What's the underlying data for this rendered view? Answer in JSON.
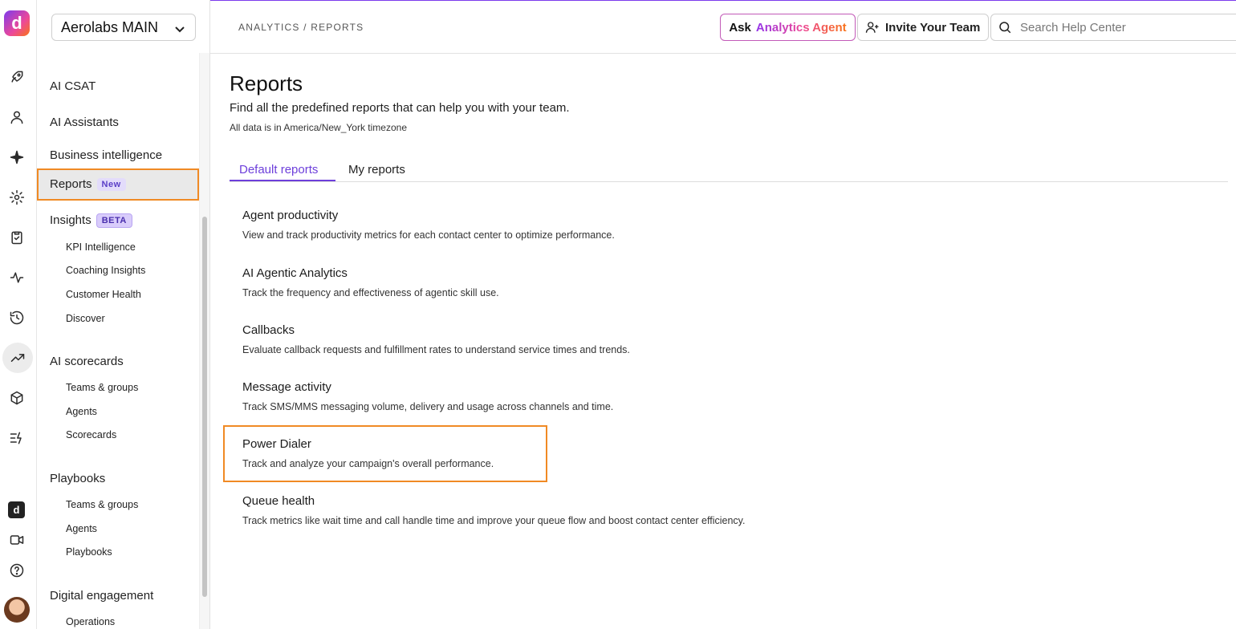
{
  "workspace": {
    "name": "Aerolabs MAIN"
  },
  "breadcrumb": "ANALYTICS / REPORTS",
  "header": {
    "ask_prefix": "Ask",
    "ask_agent": "Analytics Agent",
    "invite": "Invite Your Team",
    "search_placeholder": "Search Help Center"
  },
  "sidebar": {
    "items": [
      {
        "label": "AI CSAT"
      },
      {
        "label": "AI Assistants"
      },
      {
        "label": "Business intelligence"
      },
      {
        "label": "Reports",
        "badge": "New"
      },
      {
        "label": "Insights",
        "badge": "BETA"
      },
      {
        "label": "AI scorecards"
      },
      {
        "label": "Playbooks"
      },
      {
        "label": "Digital engagement"
      }
    ],
    "insights_sub": [
      "KPI Intelligence",
      "Coaching Insights",
      "Customer Health",
      "Discover"
    ],
    "scorecards_sub": [
      "Teams & groups",
      "Agents",
      "Scorecards"
    ],
    "playbooks_sub": [
      "Teams & groups",
      "Agents",
      "Playbooks"
    ],
    "digital_sub": [
      "Operations"
    ]
  },
  "page": {
    "title": "Reports",
    "subtitle": "Find all the predefined reports that can help you with your team.",
    "timezone": "All data is in America/New_York timezone",
    "tabs": [
      "Default reports",
      "My reports"
    ]
  },
  "reports": [
    {
      "title": "Agent productivity",
      "desc": "View and track productivity metrics for each contact center to optimize performance."
    },
    {
      "title": "AI Agentic Analytics",
      "desc": "Track the frequency and effectiveness of agentic skill use."
    },
    {
      "title": "Callbacks",
      "desc": "Evaluate callback requests and fulfillment rates to understand service times and trends."
    },
    {
      "title": "Message activity",
      "desc": "Track SMS/MMS messaging volume, delivery and usage across channels and time."
    },
    {
      "title": "Power Dialer",
      "desc": "Track and analyze your campaign's overall performance."
    },
    {
      "title": "Queue health",
      "desc": "Track metrics like wait time and call handle time and improve your queue flow and boost contact center efficiency."
    }
  ],
  "colors": {
    "accent": "#6d3fdb",
    "highlight": "#f08a24"
  }
}
